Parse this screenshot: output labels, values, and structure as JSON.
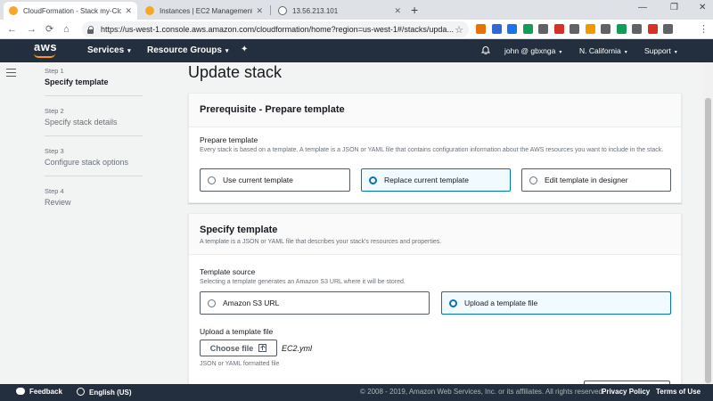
{
  "browser": {
    "tabs": [
      {
        "title": "CloudFormation - Stack my-Clo...",
        "active": true,
        "favicon_color": "#f7a723"
      },
      {
        "title": "Instances | EC2 Management Co...",
        "active": false,
        "favicon_color": "#f7a723"
      },
      {
        "title": "13.56.213.101",
        "active": false,
        "favicon_color": "#5f6368"
      }
    ],
    "new_tab": "+",
    "window_controls": {
      "minimize": "—",
      "restore": "❐",
      "close": "✕"
    },
    "nav": {
      "back": "←",
      "forward": "→",
      "reload": "⟳",
      "home": "⌂"
    },
    "url": "https://us-west-1.console.aws.amazon.com/cloudformation/home?region=us-west-1#/stacks/upda...",
    "star": "☆",
    "extension_colors": [
      "#e8710a",
      "#3367d6",
      "#1a73e8",
      "#0f9d58",
      "#5f6368",
      "#d93025",
      "#5f6368",
      "#f29900",
      "#5f6368",
      "#0f9d58",
      "#5f6368",
      "#d93025",
      "#5f6368"
    ],
    "menu": "⋮"
  },
  "aws_nav": {
    "logo": "aws",
    "services": "Services",
    "resource_groups": "Resource Groups",
    "user": "john @ gbxnga",
    "region": "N. California",
    "support": "Support",
    "caret": "▾",
    "pin": "✦"
  },
  "steps": [
    {
      "num": "Step 1",
      "label": "Specify template",
      "active": true
    },
    {
      "num": "Step 2",
      "label": "Specify stack details",
      "active": false
    },
    {
      "num": "Step 3",
      "label": "Configure stack options",
      "active": false
    },
    {
      "num": "Step 4",
      "label": "Review",
      "active": false
    }
  ],
  "page_title": "Update stack",
  "prerequisite": {
    "heading": "Prerequisite - Prepare template",
    "label": "Prepare template",
    "description": "Every stack is based on a template. A template is a JSON or YAML file that contains configuration information about the AWS resources you want to include in the stack.",
    "options": [
      {
        "label": "Use current template",
        "selected": false
      },
      {
        "label": "Replace current template",
        "selected": true
      },
      {
        "label": "Edit template in designer",
        "selected": false
      }
    ]
  },
  "specify_template": {
    "heading": "Specify template",
    "subheading": "A template is a JSON or YAML file that describes your stack's resources and properties.",
    "source_label": "Template source",
    "source_desc": "Selecting a template generates an Amazon S3 URL where it will be stored.",
    "sources": [
      {
        "label": "Amazon S3 URL",
        "selected": false
      },
      {
        "label": "Upload a template file",
        "selected": true
      }
    ],
    "upload_label": "Upload a template file",
    "choose_file": "Choose file",
    "filename": "EC2.yml",
    "format_hint": "JSON or YAML formatted file"
  },
  "footer": {
    "feedback": "Feedback",
    "language": "English (US)",
    "copyright": "© 2008 - 2019, Amazon Web Services, Inc. or its affiliates. All rights reserved.",
    "privacy": "Privacy Policy",
    "terms": "Terms of Use"
  },
  "colors": {
    "aws_navy": "#232f3e",
    "aws_orange": "#ff9900",
    "selected_blue": "#0073bb"
  }
}
